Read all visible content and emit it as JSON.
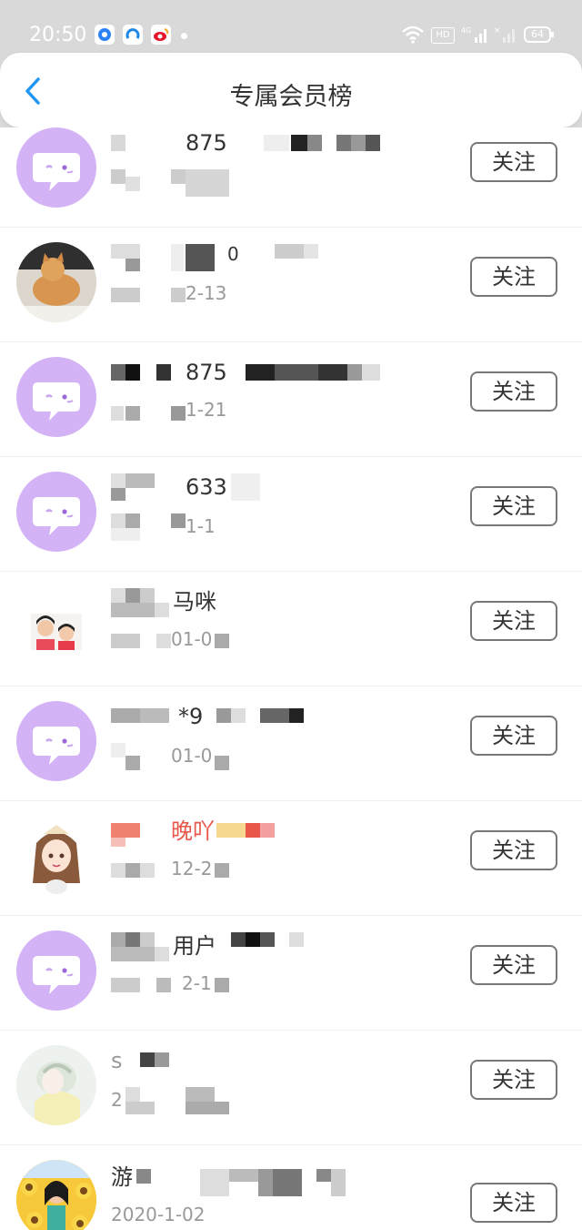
{
  "status_bar": {
    "time": "20:50",
    "battery": "64",
    "network": "4G",
    "hd": "HD"
  },
  "header": {
    "title": "专属会员榜",
    "back_icon": "chevron-left-icon"
  },
  "follow_label": "关注",
  "users": [
    {
      "name_fragment": "875",
      "date_fragment": "",
      "avatar": "default"
    },
    {
      "name_fragment": "0",
      "date_fragment": "2-13",
      "avatar": "cat-photo"
    },
    {
      "name_fragment": "875",
      "date_fragment": "1-21",
      "avatar": "default"
    },
    {
      "name_fragment": "633",
      "date_fragment": "1-1",
      "avatar": "default"
    },
    {
      "name_fragment": "马咪",
      "date_fragment": "01-0",
      "avatar": "family-photo"
    },
    {
      "name_fragment": "*9",
      "date_fragment": "01-0",
      "avatar": "default"
    },
    {
      "name_fragment": "晚吖",
      "date_fragment": "12-2",
      "avatar": "anime-girl"
    },
    {
      "name_fragment": "用户",
      "date_fragment": "2-1",
      "avatar": "default"
    },
    {
      "name_fragment": "s",
      "date_fragment": "2",
      "avatar": "pastel-drawing"
    },
    {
      "name_fragment": "游",
      "date_fragment": "2020-1-02",
      "avatar": "sunflower-photo"
    }
  ]
}
